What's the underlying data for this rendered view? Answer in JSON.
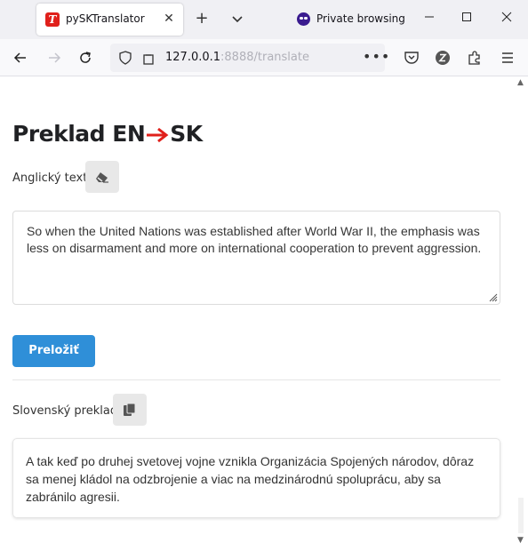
{
  "browser": {
    "tab_title": "pySKTranslator",
    "tab_favicon_letter": "T",
    "private_label": "Private browsing",
    "url_host": "127.0.0.1",
    "url_rest": ":8888/translate"
  },
  "page": {
    "title_left": "Preklad EN",
    "title_right": "SK",
    "arrow_color": "#e0201b",
    "english_label": "Anglický text",
    "english_text": "So when the United Nations was established after World War II, the emphasis was less on disarmament and more on international cooperation to prevent aggression.",
    "translate_button": "Preložiť",
    "slovak_label": "Slovenský preklad",
    "slovak_text": "A tak keď po druhej svetovej vojne vznikla Organizácia Spojených národov, dôraz sa menej kládol na odzbrojenie a viac na medzinárodnú spoluprácu, aby sa zabránilo agresii."
  },
  "colors": {
    "primary_button": "#2f8fd8",
    "accent_red": "#e0201b"
  }
}
